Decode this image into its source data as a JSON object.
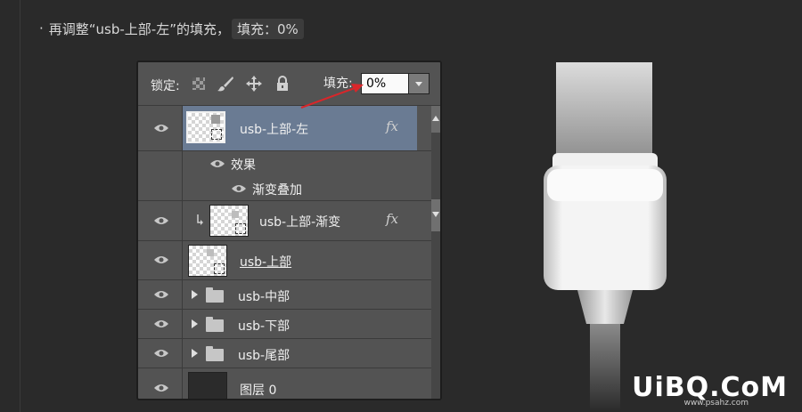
{
  "instruction": {
    "bullet": "·",
    "text": "再调整“usb-上部-左”的填充，",
    "highlight": "填充：0%"
  },
  "panel": {
    "lock_label": "锁定:",
    "fill_label": "填充:",
    "fill_value": "0%",
    "layers": [
      {
        "name": "usb-上部-左",
        "selected": true,
        "fx": "fx"
      },
      {
        "name": "效果"
      },
      {
        "name": "渐变叠加"
      },
      {
        "name": "usb-上部-渐变",
        "fx": "fx"
      },
      {
        "name": "usb-上部"
      },
      {
        "name": "usb-中部"
      },
      {
        "name": "usb-下部"
      },
      {
        "name": "usb-尾部"
      },
      {
        "name": "图层 0"
      }
    ]
  },
  "watermark": {
    "text": "UiBQ.CoM",
    "sub": "www.psahz.com"
  },
  "colors": {
    "selected_row": "#6a7b93",
    "arrow": "#d9262a"
  }
}
